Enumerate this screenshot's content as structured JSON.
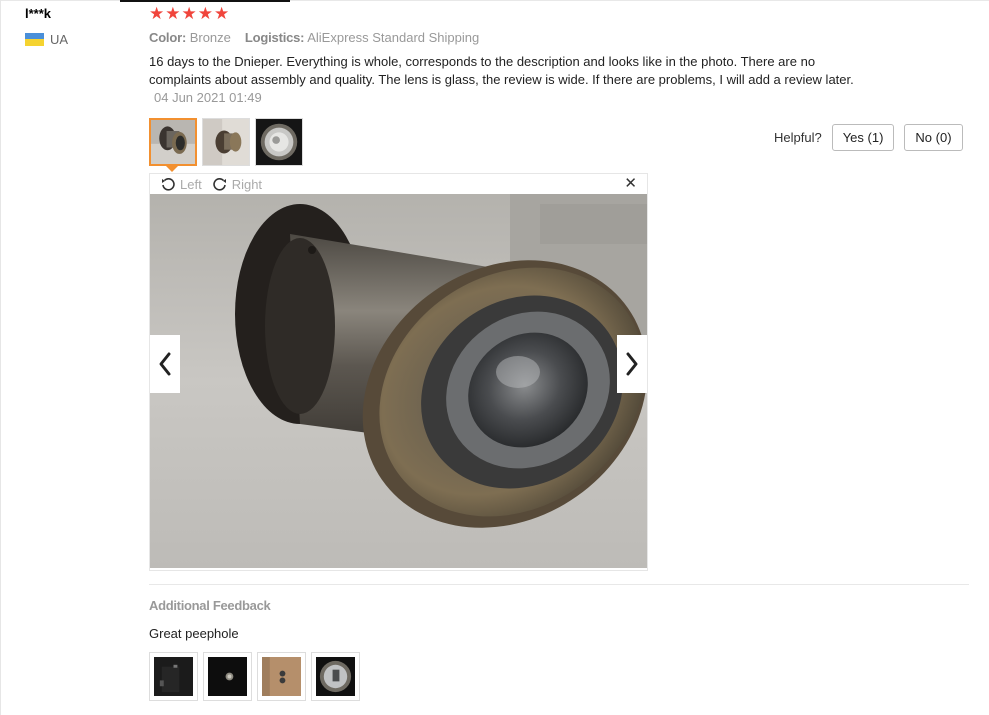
{
  "reviewer": {
    "name": "l***k",
    "country": "UA"
  },
  "rating": {
    "stars": 5,
    "icons": [
      "star-icon",
      "star-icon",
      "star-icon",
      "star-icon",
      "star-icon"
    ]
  },
  "sku": {
    "color_key": "Color:",
    "color_value": "Bronze",
    "logistics_key": "Logistics:",
    "logistics_value": "AliExpress Standard Shipping"
  },
  "review": {
    "text": "16 days to the Dnieper. Everything is whole, corresponds to the description and looks like in the photo. There are no complaints about assembly and quality. The lens is glass, the review is wide. If there are problems, I will add a review later.",
    "date": "04 Jun 2021 01:49"
  },
  "helpful": {
    "label": "Helpful?",
    "yes_label": "Yes (1)",
    "no_label": "No (0)"
  },
  "viewer": {
    "rotate_left_label": "Left",
    "rotate_right_label": "Right",
    "close_glyph": "✕",
    "image_name": "bronze-peephole-photo"
  },
  "additional_feedback": {
    "title": "Additional Feedback",
    "text": "Great peephole"
  },
  "colors": {
    "star": "#f0453c",
    "active_thumb_border": "#f29030",
    "muted_text": "#999999"
  }
}
